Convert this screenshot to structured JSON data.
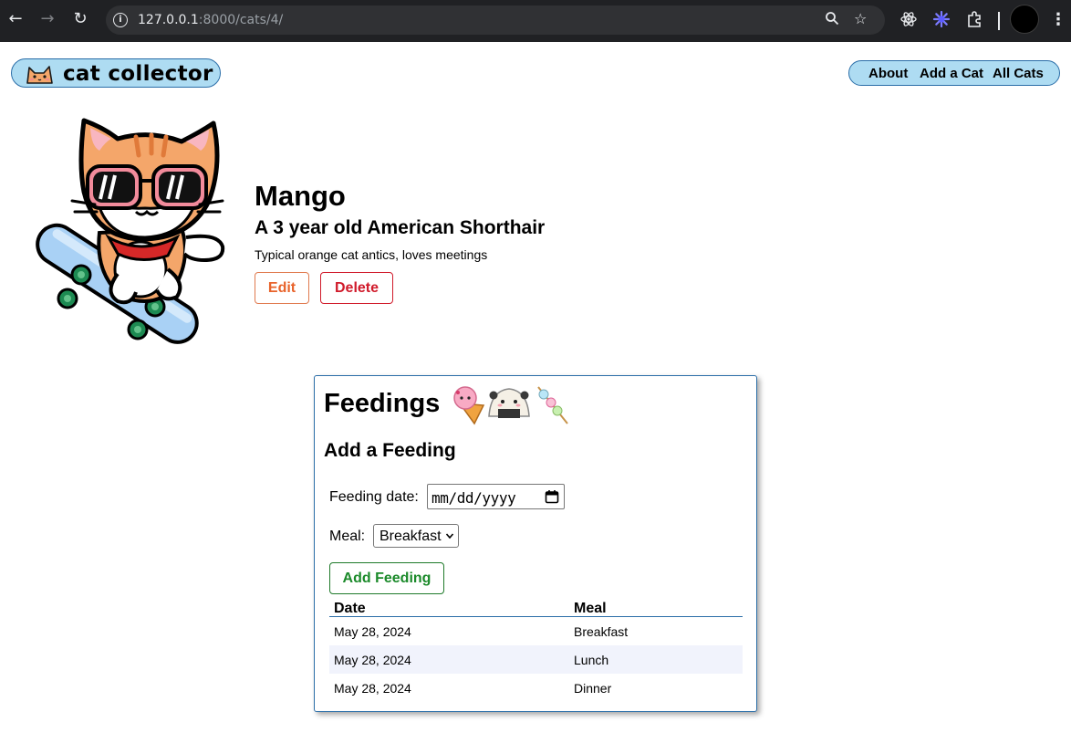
{
  "browser": {
    "url_host": "127.0.0.1",
    "url_path": ":8000/cats/4/"
  },
  "header": {
    "logo_text": "cat collector",
    "nav": [
      "About",
      "Add a Cat",
      "All Cats"
    ]
  },
  "cat": {
    "name": "Mango",
    "subtitle": "A 3 year old American Shorthair",
    "description": "Typical orange cat antics, loves meetings",
    "edit_label": "Edit",
    "delete_label": "Delete"
  },
  "feedings": {
    "title": "Feedings",
    "add_title": "Add a Feeding",
    "date_label": "Feeding date:",
    "date_placeholder": "mm/dd/yyyy",
    "meal_label": "Meal:",
    "meal_value": "Breakfast",
    "add_button": "Add Feeding",
    "columns": [
      "Date",
      "Meal"
    ],
    "rows": [
      {
        "date": "May 28, 2024",
        "meal": "Breakfast"
      },
      {
        "date": "May 28, 2024",
        "meal": "Lunch"
      },
      {
        "date": "May 28, 2024",
        "meal": "Dinner"
      }
    ]
  },
  "colors": {
    "accent_blue": "#aedcf2",
    "border_blue": "#2b6ea8",
    "edit_orange": "#e8632b",
    "delete_red": "#d01a2a",
    "add_green": "#1b8a2a",
    "row_alt": "#f1f3fc"
  }
}
